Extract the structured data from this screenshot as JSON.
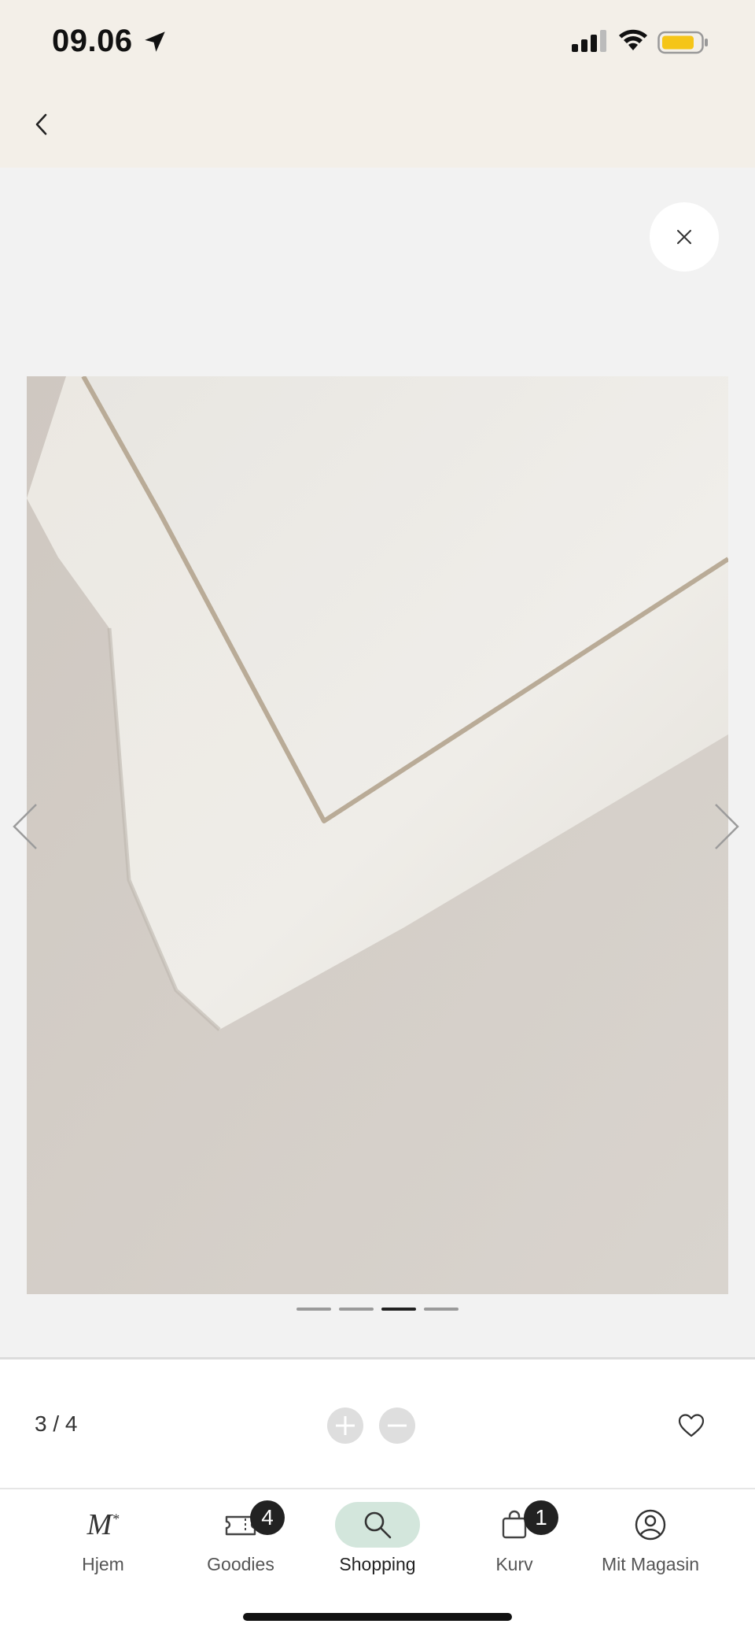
{
  "status_bar": {
    "time": "09.06",
    "battery_color": "#f5c518"
  },
  "header": {
    "back_icon": "chevron-left-icon"
  },
  "gallery": {
    "close_icon": "close-icon",
    "image_alt": "Close-up of an off-white pillowcase with a beige embroidered border",
    "page_count": 4,
    "current_page": 3,
    "counter_text": "3 / 4",
    "prev_icon": "chevron-left-icon",
    "next_icon": "chevron-right-icon"
  },
  "controls": {
    "zoom_in_icon": "plus-circle-icon",
    "zoom_out_icon": "minus-circle-icon",
    "favorite_icon": "heart-icon"
  },
  "tabbar": {
    "items": [
      {
        "label": "Hjem",
        "icon": "magasin-logo-icon",
        "logo_text": "M"
      },
      {
        "label": "Goodies",
        "icon": "ticket-icon",
        "badge": "4"
      },
      {
        "label": "Shopping",
        "icon": "search-icon",
        "active": true
      },
      {
        "label": "Kurv",
        "icon": "shopping-bag-icon",
        "badge": "1"
      },
      {
        "label": "Mit Magasin",
        "icon": "account-icon"
      }
    ],
    "active_color": "#d3e6dc"
  }
}
